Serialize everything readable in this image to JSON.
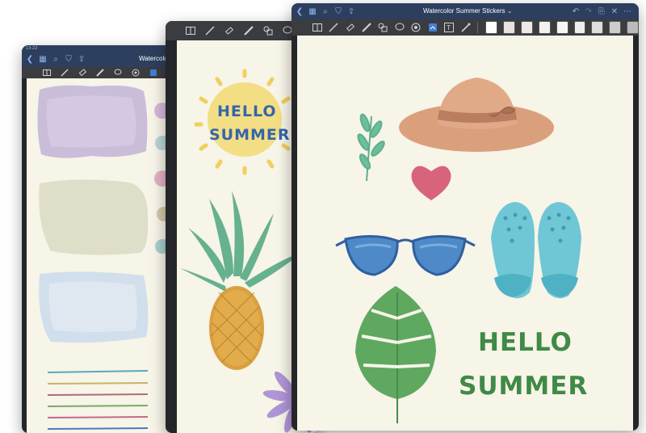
{
  "left_tablet": {
    "status_time": "13:22",
    "title": "Watercolor"
  },
  "middle_tablet": {
    "sticker_text": {
      "line1": "HELLO",
      "line2": "SUMMER"
    }
  },
  "front_tablet": {
    "title": "Watercolor  Summer Stickers",
    "title_chevron": "⌄",
    "sticker_text": {
      "line1": "HELLO",
      "line2": "SUMMER"
    },
    "swatches": [
      "#e7e1df",
      "#eee9e6",
      "#f4f1ee",
      "#f7f6f4",
      "#eeeeee",
      "#dddddd",
      "#cccccc",
      "#bbbbbb"
    ]
  },
  "colors": {
    "nav_bar": "#2d3f5f",
    "toolbar": "#3a3c40",
    "paper": "#f7f4e8",
    "nav_icon": "#8fb2ea",
    "hello_green": "#3f8a46",
    "hello_blue": "#3566a8"
  }
}
